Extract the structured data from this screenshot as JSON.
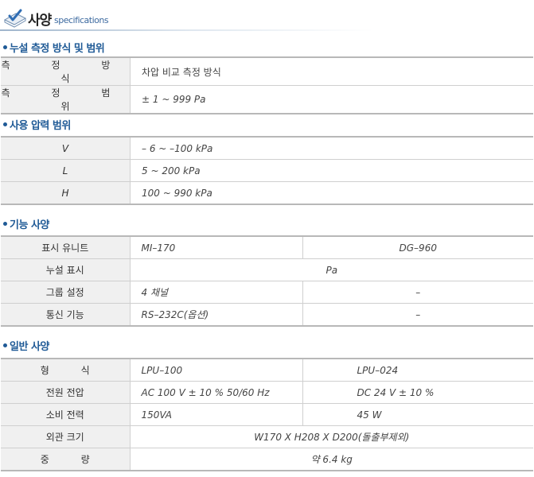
{
  "header": {
    "title": "사양",
    "subtitle": "specifications"
  },
  "sections": [
    {
      "title": "누설 측정 방식 및 범위",
      "rows": [
        {
          "label": "측 정 방 식",
          "value": "차압 비교 측정 방식"
        },
        {
          "label": "측 정 범 위",
          "value": "± 1 ~ 999 Pa"
        }
      ]
    },
    {
      "title": "사용 압력 범위",
      "rows": [
        {
          "label": "V",
          "value": "– 6 ~ –100 kPa"
        },
        {
          "label": "L",
          "value": "5 ~ 200 kPa"
        },
        {
          "label": "H",
          "value": "100 ~ 990 kPa"
        }
      ]
    },
    {
      "title": "기능 사양",
      "rows": [
        {
          "label": "표시 유니트",
          "col1": "MI–170",
          "col2": "DG–960"
        },
        {
          "label": "누설 표시",
          "merged": "Pa"
        },
        {
          "label": "그룹 설정",
          "col1": "4 채널",
          "col2": "–"
        },
        {
          "label": "통신 기능",
          "col1": "RS–232C(옵션)",
          "col2": "–"
        }
      ]
    },
    {
      "title": "일반 사양",
      "rows": [
        {
          "label": "형 식",
          "col1": "LPU–100",
          "col2": "LPU–024"
        },
        {
          "label": "전원 전압",
          "col1": "AC 100 V ± 10 % 50/60 Hz",
          "col2": "DC 24 V ± 10 %"
        },
        {
          "label": "소비 전력",
          "col1": "150VA",
          "col2": "45 W"
        },
        {
          "label": "외관 크기",
          "merged": "W170 X H208 X D200(돌출부제외)"
        },
        {
          "label": "중 량",
          "merged": "약 6.4 kg"
        }
      ]
    }
  ]
}
